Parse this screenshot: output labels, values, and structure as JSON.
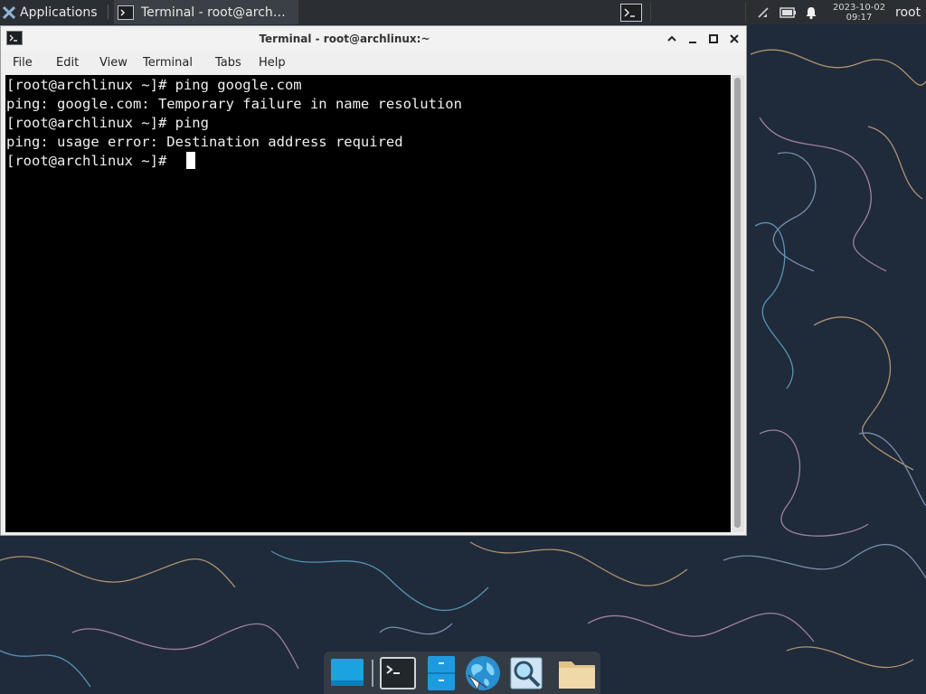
{
  "top_panel": {
    "applications_label": "Applications",
    "task_title": "Terminal - root@arch…",
    "clock_date": "2023-10-02",
    "clock_time": "09:17",
    "user": "root"
  },
  "window": {
    "title": "Terminal - root@archlinux:~",
    "menu": [
      "File",
      "Edit",
      "View",
      "Terminal",
      "Tabs",
      "Help"
    ]
  },
  "terminal": {
    "lines": [
      "[root@archlinux ~]# ping google.com",
      "ping: google.com: Temporary failure in name resolution",
      "[root@archlinux ~]# ping",
      "ping: usage error: Destination address required",
      "[root@archlinux ~]# "
    ]
  },
  "dock": {
    "items": [
      "show-desktop-icon",
      "terminal-icon",
      "file-cabinet-icon",
      "web-browser-icon",
      "search-icon",
      "folder-icon"
    ]
  },
  "colors": {
    "wallpaper": "#1f2a3a",
    "panel": "#2b2f33",
    "terminal_bg": "#000000",
    "terminal_fg": "#f0f0f0"
  }
}
